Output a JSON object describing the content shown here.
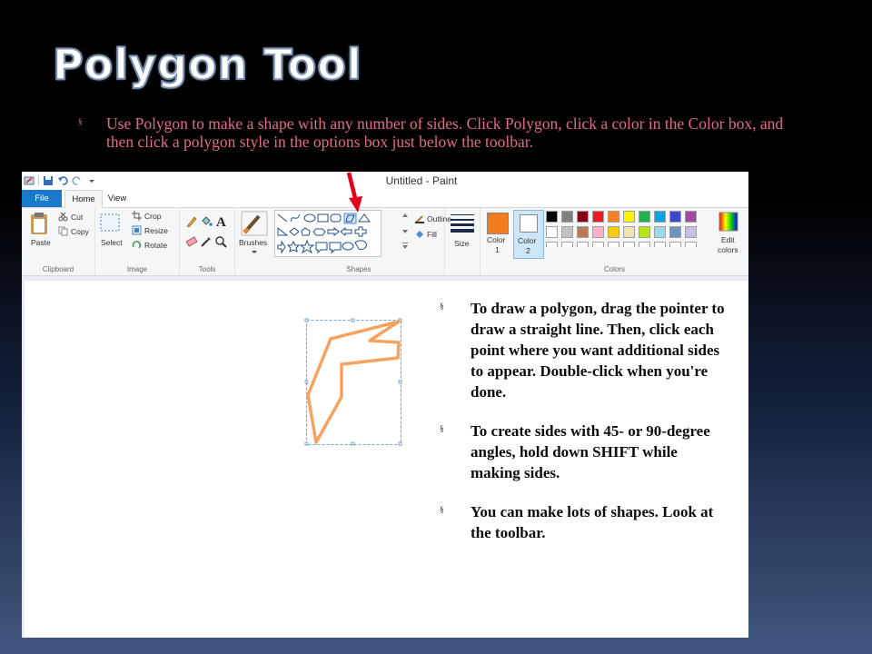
{
  "slide": {
    "title": "Polygon Tool",
    "intro_bullet": "Use Polygon to make a shape with any number of sides. Click Polygon, click a color in the Color box, and then click a polygon style in the options box just below the toolbar.",
    "right_bullets": [
      "To draw a polygon, drag the pointer to draw a straight line. Then, click each point where you want additional sides to appear. Double-click when you're done.",
      " To create sides with 45- or 90-degree angles, hold down SHIFT while making sides.",
      "You can make lots of shapes. Look at the toolbar."
    ],
    "bullet_glyph": "§",
    "accent_text_color": "#e26c80",
    "arrow_color": "#e3001b"
  },
  "paint": {
    "window_title": "Untitled - Paint",
    "tabs": {
      "file": "File",
      "home": "Home",
      "view": "View"
    },
    "clipboard": {
      "paste": "Paste",
      "cut": "Cut",
      "copy": "Copy",
      "group": "Clipboard"
    },
    "image": {
      "select": "Select",
      "crop": "Crop",
      "resize": "Resize",
      "rotate": "Rotate",
      "group": "Image"
    },
    "tools": {
      "group": "Tools"
    },
    "brushes": {
      "label": "Brushes"
    },
    "shapes": {
      "outline": "Outline",
      "fill": "Fill",
      "group": "Shapes"
    },
    "size": {
      "label": "Size"
    },
    "colors": {
      "color1": "Color",
      "color1_num": "1",
      "color2": "Color",
      "color2_num": "2",
      "edit": "Edit",
      "edit2": "colors",
      "group": "Colors",
      "color1_value": "#f47a20",
      "palette_row1": [
        "#000000",
        "#7f7f7f",
        "#880015",
        "#ed1c24",
        "#ff7f27",
        "#fff200",
        "#22b14c",
        "#00a2e8",
        "#3f48cc",
        "#a349a4"
      ],
      "palette_row2": [
        "#ffffff",
        "#c3c3c3",
        "#b97a57",
        "#ffaec9",
        "#ffc90e",
        "#efe4b0",
        "#b5e61d",
        "#99d9ea",
        "#7092be",
        "#c8bfe7"
      ]
    },
    "drawn_polygon_color": "#f4a460"
  }
}
